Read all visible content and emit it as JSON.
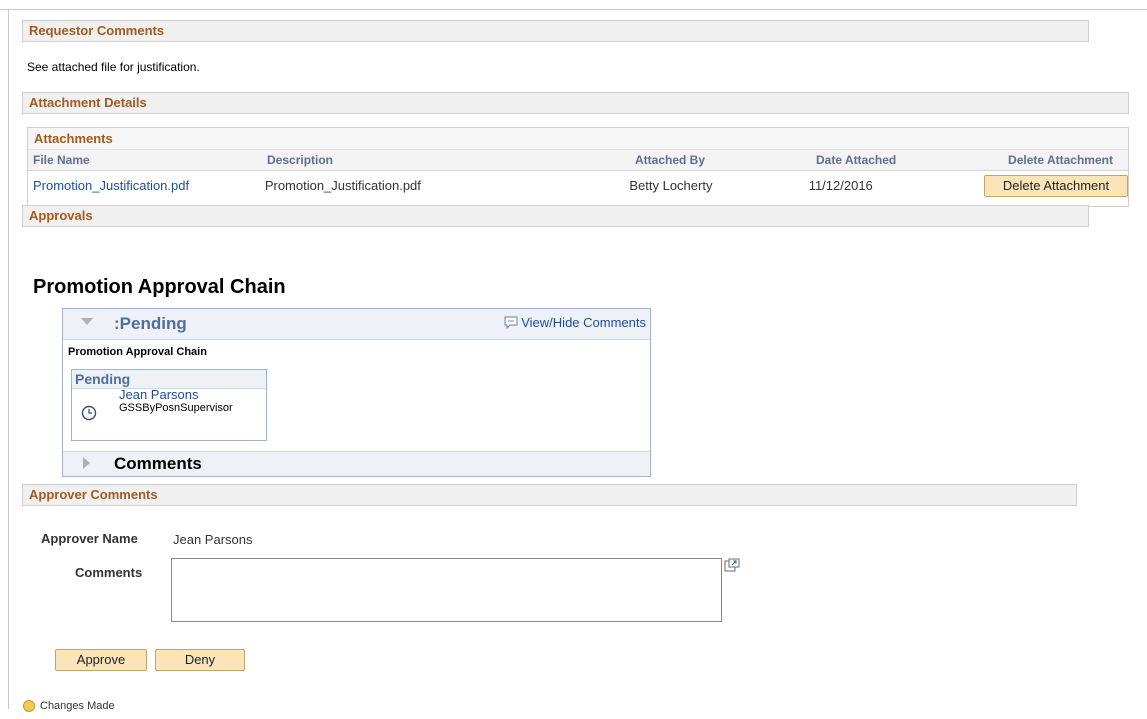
{
  "requestor": {
    "header": "Requestor Comments",
    "text": "See attached file for justification."
  },
  "attachment_details": {
    "header": "Attachment Details",
    "grid_title": "Attachments",
    "columns": [
      "File Name",
      "Description",
      "Attached By",
      "Date Attached",
      "Delete Attachment"
    ],
    "rows": [
      {
        "file_name": "Promotion_Justification.pdf",
        "description": "Promotion_Justification.pdf",
        "attached_by": "Betty Locherty",
        "date_attached": "11/12/2016",
        "delete_label": "Delete Attachment"
      }
    ]
  },
  "approvals": {
    "header": "Approvals",
    "chain_title": "Promotion Approval Chain",
    "status_title": ":Pending",
    "view_hide_label": "View/Hide Comments",
    "chain_subtitle": "Promotion Approval Chain",
    "step": {
      "status": "Pending",
      "approver": "Jean Parsons",
      "role": "GSSByPosnSupervisor"
    },
    "comments_label": "Comments"
  },
  "approver_comments": {
    "header": "Approver Comments",
    "name_label": "Approver Name",
    "name_value": "Jean Parsons",
    "comments_label": "Comments",
    "comments_value": ""
  },
  "actions": {
    "approve_label": "Approve",
    "deny_label": "Deny"
  },
  "status": {
    "changes_label": "Changes Made"
  },
  "colors": {
    "section_title": "#a35a1e",
    "link": "#1f4e96",
    "button_bg": "#fbe5b8",
    "chain_header_text": "#4e6da0"
  }
}
